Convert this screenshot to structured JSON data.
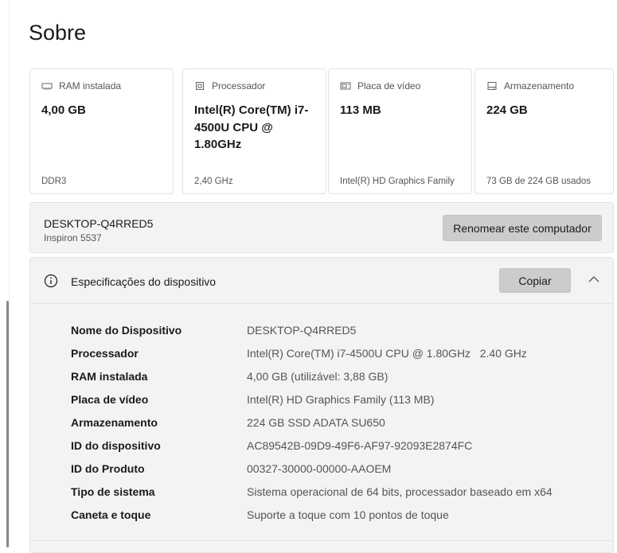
{
  "page": {
    "title": "Sobre"
  },
  "cards": [
    {
      "label": "RAM instalada",
      "value": "4,00 GB",
      "sub": "DDR3",
      "icon": "ram-icon"
    },
    {
      "label": "Processador",
      "value": "Intel(R) Core(TM) i7-4500U CPU @ 1.80GHz",
      "sub": "2,40 GHz",
      "icon": "processor-icon"
    },
    {
      "label": "Placa de vídeo",
      "value": "113 MB",
      "sub": "Intel(R) HD Graphics Family",
      "icon": "graphics-card-icon"
    },
    {
      "label": "Armazenamento",
      "value": "224 GB",
      "sub": "73 GB de 224 GB usados",
      "icon": "storage-icon"
    }
  ],
  "device": {
    "name": "DESKTOP-Q4RRED5",
    "model": "Inspiron 5537",
    "rename_label": "Renomear este computador"
  },
  "specs": {
    "title": "Especificações do dispositivo",
    "copy_label": "Copiar",
    "rows": [
      {
        "key": "Nome do Dispositivo",
        "value": "DESKTOP-Q4RRED5"
      },
      {
        "key": "Processador",
        "value": "Intel(R) Core(TM) i7-4500U CPU @ 1.80GHz   2.40 GHz"
      },
      {
        "key": "RAM instalada",
        "value": "4,00 GB (utilizável: 3,88 GB)"
      },
      {
        "key": "Placa de vídeo",
        "value": "Intel(R) HD Graphics Family (113 MB)"
      },
      {
        "key": "Armazenamento",
        "value": "224 GB SSD ADATA SU650"
      },
      {
        "key": "ID do dispositivo",
        "value": "AC89542B-09D9-49F6-AF97-92093E2874FC"
      },
      {
        "key": "ID do Produto",
        "value": "00327-30000-00000-AAOEM"
      },
      {
        "key": "Tipo de sistema",
        "value": "Sistema operacional de 64 bits, processador baseado em x64"
      },
      {
        "key": "Caneta e toque",
        "value": "Suporte a toque com 10 pontos de toque"
      }
    ]
  }
}
